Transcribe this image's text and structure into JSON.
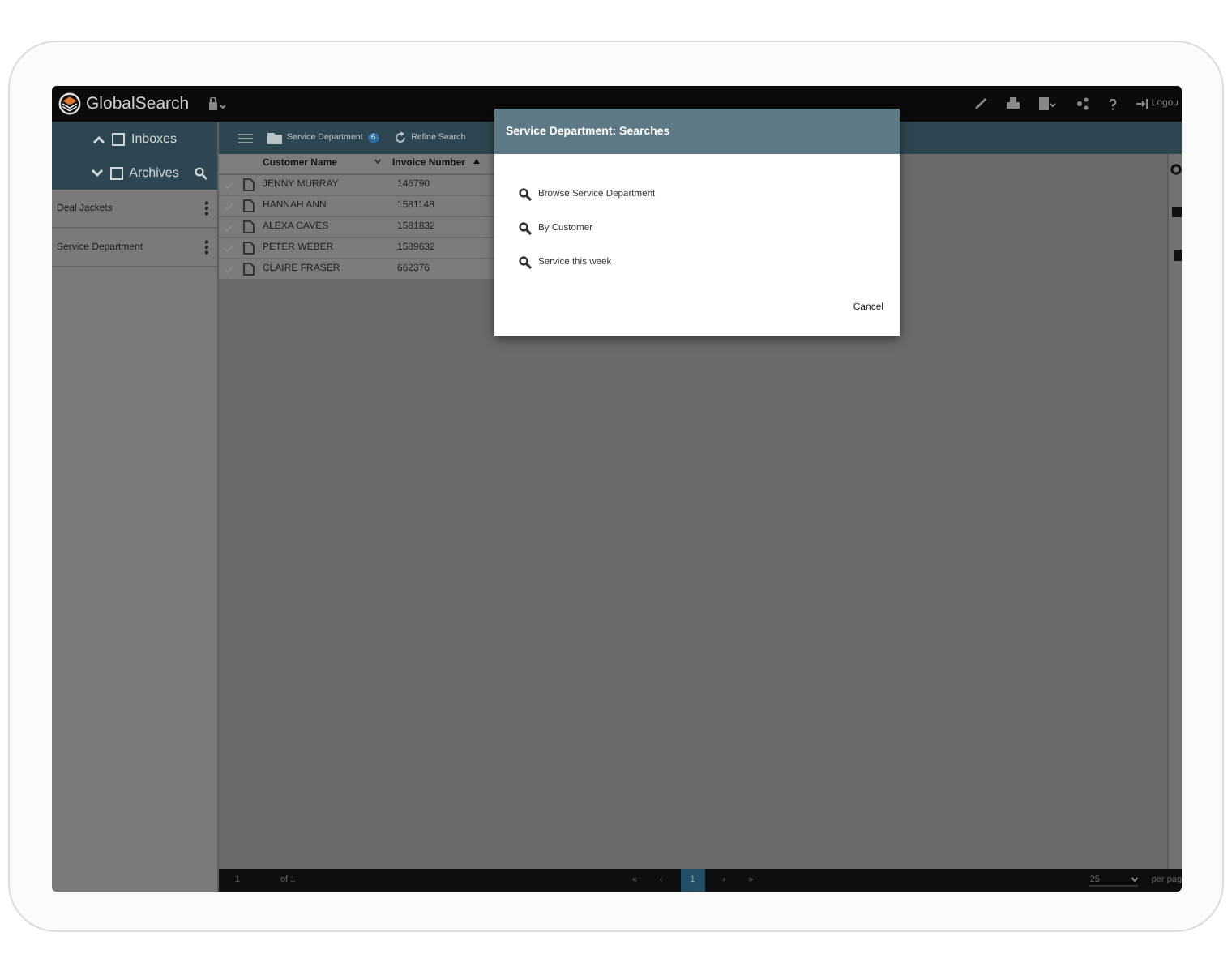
{
  "topbar": {
    "brand": "GlobalSearch",
    "logout": "Logou"
  },
  "sidebar": {
    "nav": [
      {
        "label": "Inboxes",
        "expanded": false
      },
      {
        "label": "Archives",
        "expanded": true
      }
    ],
    "items": [
      {
        "label": "Deal Jackets"
      },
      {
        "label": "Service Department"
      }
    ]
  },
  "toolbar": {
    "folder": "Service Department",
    "count": "6",
    "refine": "Refine Search"
  },
  "table": {
    "columns": [
      {
        "label": "Customer Name",
        "kind": "filter"
      },
      {
        "label": "Invoice Number",
        "kind": "sort"
      }
    ],
    "rows": [
      {
        "customer": "JENNY MURRAY",
        "invoice": "146790"
      },
      {
        "customer": "HANNAH ANN",
        "invoice": "1581148"
      },
      {
        "customer": "ALEXA CAVES",
        "invoice": "1581832"
      },
      {
        "customer": "PETER WEBER",
        "invoice": "1589632"
      },
      {
        "customer": "CLAIRE FRASER",
        "invoice": "662376"
      }
    ]
  },
  "dialog": {
    "title": "Service Department: Searches",
    "items": [
      "Browse Service Department",
      "By Customer",
      "Service this week"
    ],
    "cancel": "Cancel"
  },
  "pager": {
    "page": "1",
    "of": "of 1",
    "first": "«",
    "prev": "‹",
    "pages": [
      {
        "label": "1",
        "selected": true
      }
    ],
    "next": "›",
    "last": "»",
    "per_page": "25",
    "per_page_label": "per pag"
  }
}
